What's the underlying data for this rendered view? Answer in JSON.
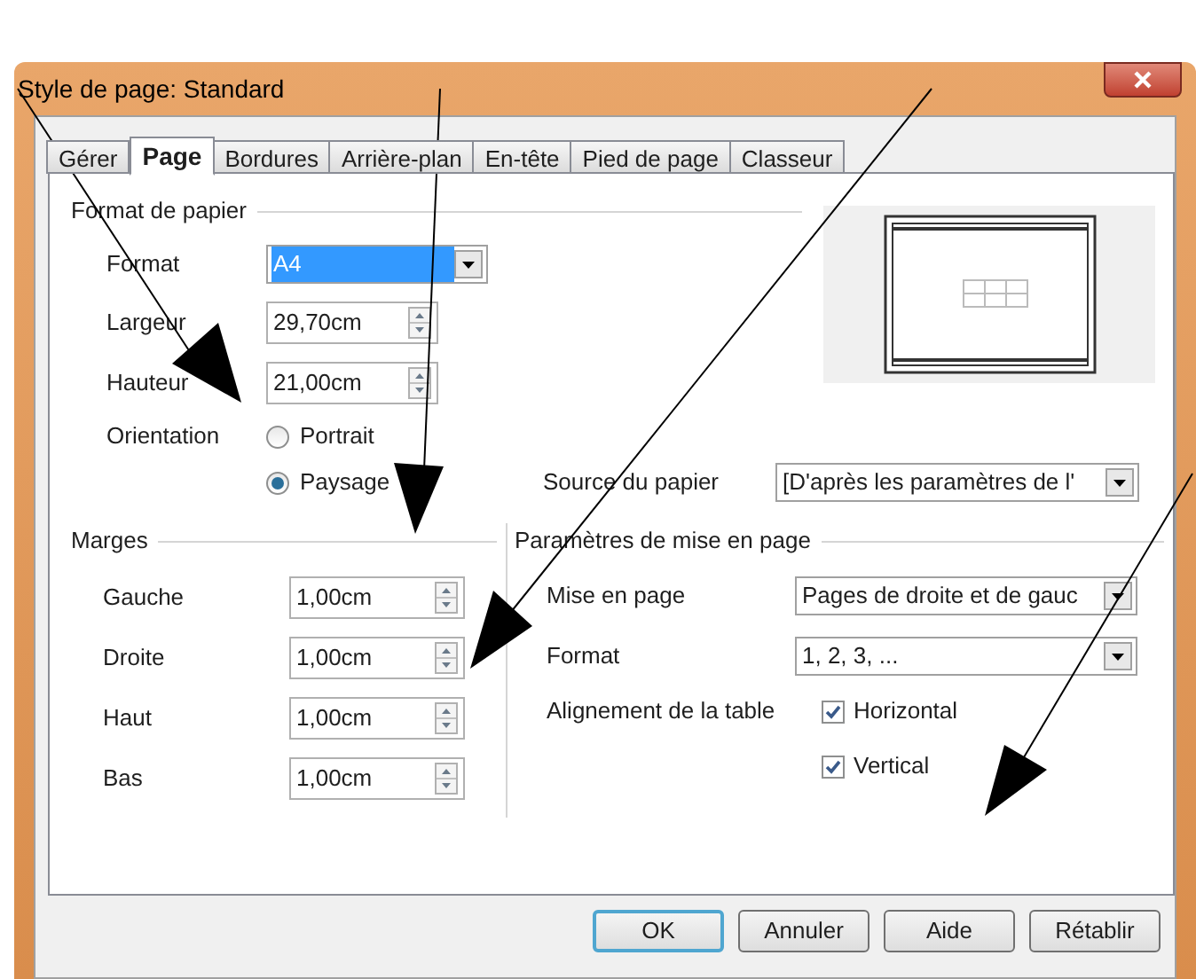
{
  "window": {
    "title": "Style de page: Standard"
  },
  "tabs": [
    {
      "label": "Gérer",
      "selected": false
    },
    {
      "label": "Page",
      "selected": true
    },
    {
      "label": "Bordures",
      "selected": false
    },
    {
      "label": "Arrière-plan",
      "selected": false
    },
    {
      "label": "En-tête",
      "selected": false
    },
    {
      "label": "Pied de page",
      "selected": false
    },
    {
      "label": "Classeur",
      "selected": false
    }
  ],
  "paper_format": {
    "legend": "Format de papier",
    "format": {
      "label": "Format",
      "value": "A4"
    },
    "width": {
      "label": "Largeur",
      "value": "29,70cm"
    },
    "height": {
      "label": "Hauteur",
      "value": "21,00cm"
    },
    "orientation": {
      "label": "Orientation",
      "options": [
        {
          "label": "Portrait",
          "selected": false
        },
        {
          "label": "Paysage",
          "selected": true
        }
      ]
    }
  },
  "paper_source": {
    "label": "Source du papier",
    "value": "[D'après les paramètres de l'"
  },
  "margins": {
    "legend": "Marges",
    "fields": [
      {
        "label": "Gauche",
        "value": "1,00cm"
      },
      {
        "label": "Droite",
        "value": "1,00cm"
      },
      {
        "label": "Haut",
        "value": "1,00cm"
      },
      {
        "label": "Bas",
        "value": "1,00cm"
      }
    ]
  },
  "layout_settings": {
    "legend": "Paramètres de mise en page",
    "page_layout": {
      "label": "Mise en page",
      "value": "Pages de droite et de gauc"
    },
    "numbering": {
      "label": "Format",
      "value": "1, 2, 3, ..."
    },
    "table_alignment": {
      "label": "Alignement de la table",
      "options": [
        {
          "label": "Horizontal",
          "checked": true
        },
        {
          "label": "Vertical",
          "checked": true
        }
      ]
    }
  },
  "buttons": [
    {
      "label": "OK",
      "default": true
    },
    {
      "label": "Annuler",
      "default": false
    },
    {
      "label": "Aide",
      "default": false
    },
    {
      "label": "Rétablir",
      "default": false
    }
  ]
}
